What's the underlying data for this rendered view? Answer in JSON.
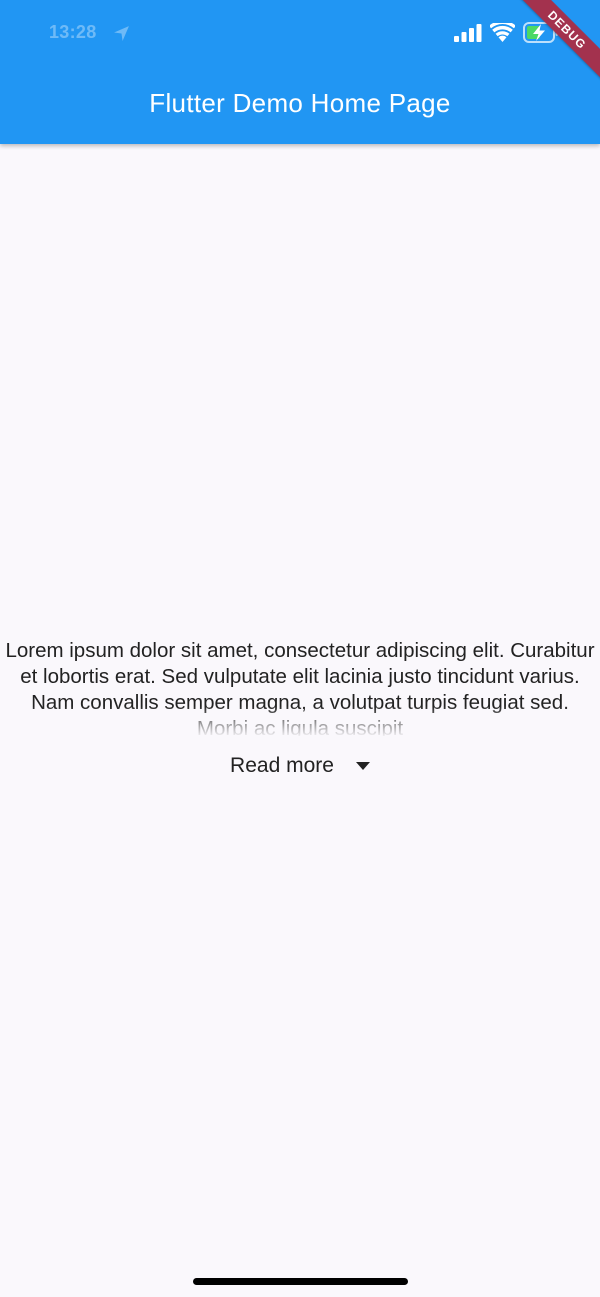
{
  "status_bar": {
    "time": "13:28",
    "icons": [
      "location-arrow-icon",
      "cellular-signal-icon",
      "wifi-icon",
      "battery-charging-icon"
    ]
  },
  "app_bar": {
    "title": "Flutter Demo Home Page",
    "background_color": "#2196F3"
  },
  "debug_banner": {
    "label": "DEBUG",
    "color": "#A3324E"
  },
  "content": {
    "text": "Lorem ipsum dolor sit amet, consectetur adipiscing elit. Curabitur et lobortis erat. Sed vulputate elit lacinia justo tincidunt varius. Nam convallis semper magna, a volutpat turpis feugiat sed. Morbi ac ligula suscipit",
    "read_more_label": "Read more",
    "read_more_icon": "arrow-drop-down-icon"
  },
  "colors": {
    "background": "#FAF8FC",
    "text": "#222222",
    "battery_fill": "#4CD964"
  }
}
